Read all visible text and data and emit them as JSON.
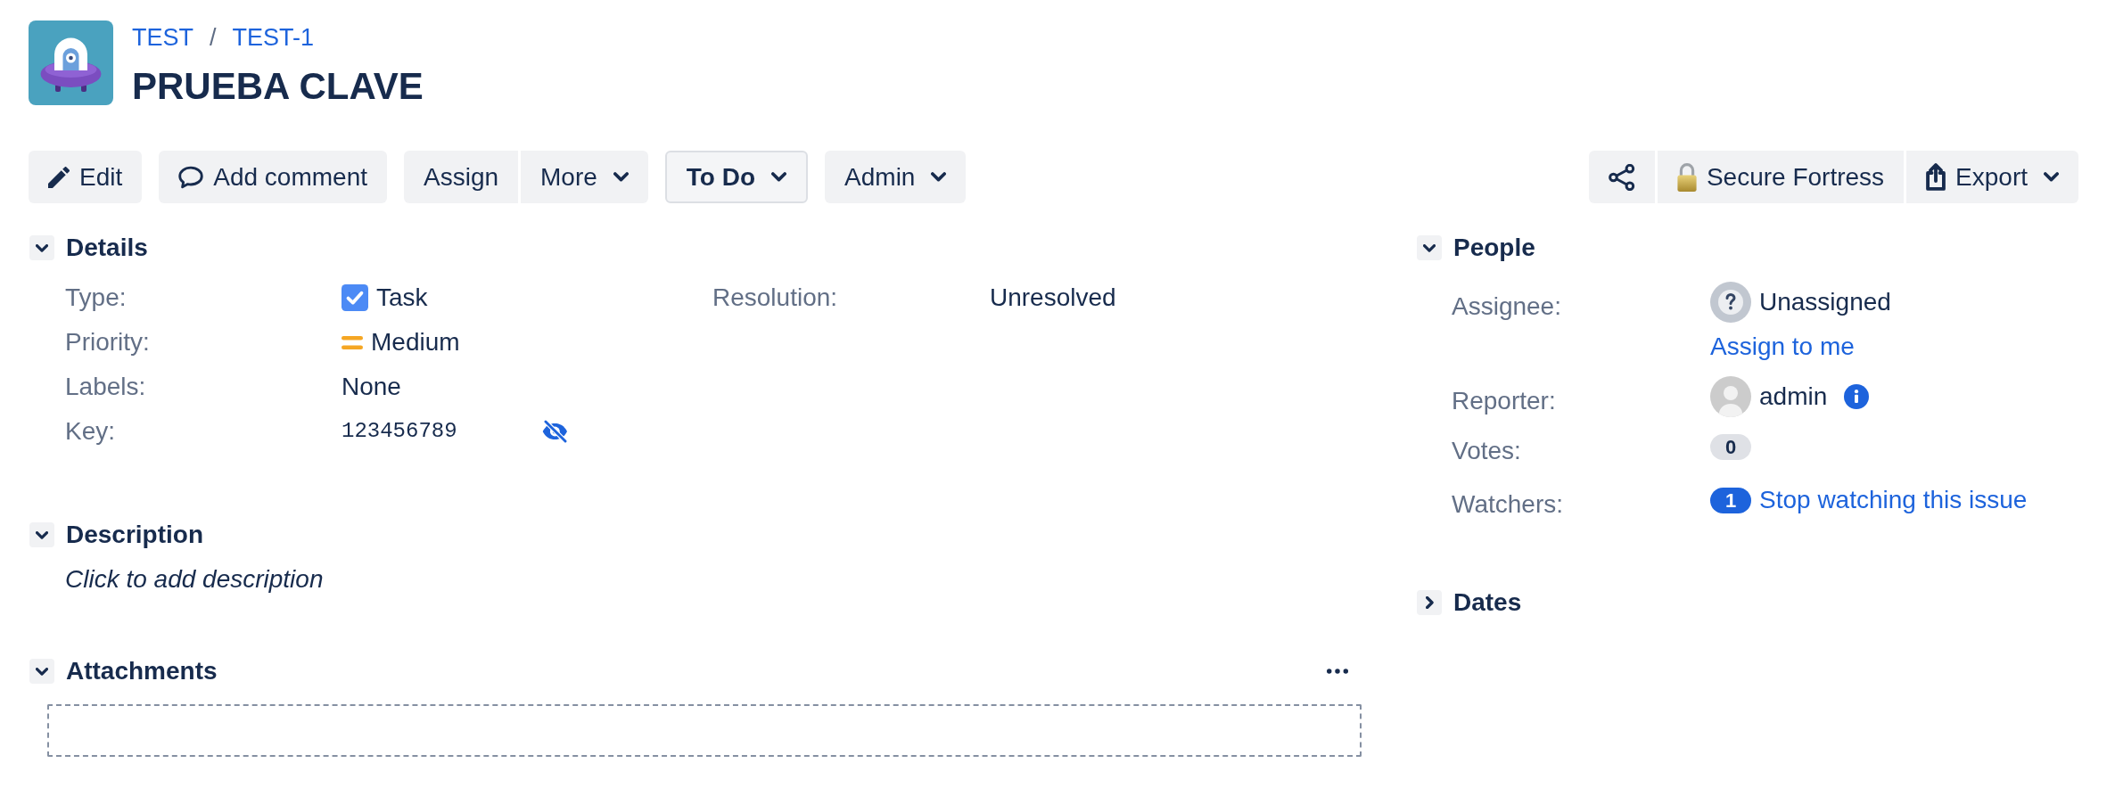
{
  "header": {
    "breadcrumbs": [
      {
        "label": "TEST"
      },
      {
        "label": "TEST-1"
      }
    ],
    "separator": "/",
    "title": "PRUEBA CLAVE"
  },
  "toolbar": {
    "left_groups": [
      [
        {
          "kind": "edit",
          "label": "Edit"
        }
      ],
      [
        {
          "kind": "comment",
          "label": "Add comment"
        }
      ],
      [
        {
          "kind": "assign",
          "label": "Assign"
        },
        {
          "kind": "more",
          "label": "More"
        }
      ],
      [
        {
          "kind": "status",
          "label": "To Do"
        }
      ],
      [
        {
          "kind": "admin",
          "label": "Admin"
        }
      ]
    ],
    "right_groups": [
      [
        {
          "kind": "share"
        },
        {
          "kind": "security",
          "label": "Secure Fortress"
        },
        {
          "kind": "export",
          "label": "Export"
        }
      ]
    ]
  },
  "details": {
    "title": "Details",
    "expanded": true,
    "fields": [
      {
        "kind": "type",
        "label": "Type:",
        "value": "Task"
      },
      {
        "kind": "priority",
        "label": "Priority:",
        "value": "Medium"
      },
      {
        "kind": "text",
        "label": "Labels:",
        "value": "None"
      },
      {
        "kind": "secret",
        "label": "Key:",
        "value": "123456789"
      }
    ],
    "side_fields": [
      {
        "kind": "text",
        "label": "Resolution:",
        "value": "Unresolved"
      }
    ]
  },
  "description": {
    "title": "Description",
    "expanded": true,
    "prompt": "Click to add description"
  },
  "attachments": {
    "title": "Attachments",
    "expanded": true
  },
  "people": {
    "title": "People",
    "expanded": true,
    "fields": [
      {
        "kind": "unassigned",
        "label": "Assignee:",
        "value": "Unassigned",
        "link": "Assign to me"
      },
      {
        "kind": "user",
        "label": "Reporter:",
        "value": "admin"
      },
      {
        "kind": "count",
        "label": "Votes:",
        "count": "0",
        "highlighted": false
      },
      {
        "kind": "count",
        "label": "Watchers:",
        "count": "1",
        "highlighted": true,
        "link": "Stop watching this issue"
      }
    ]
  },
  "dates": {
    "title": "Dates",
    "expanded": false
  }
}
